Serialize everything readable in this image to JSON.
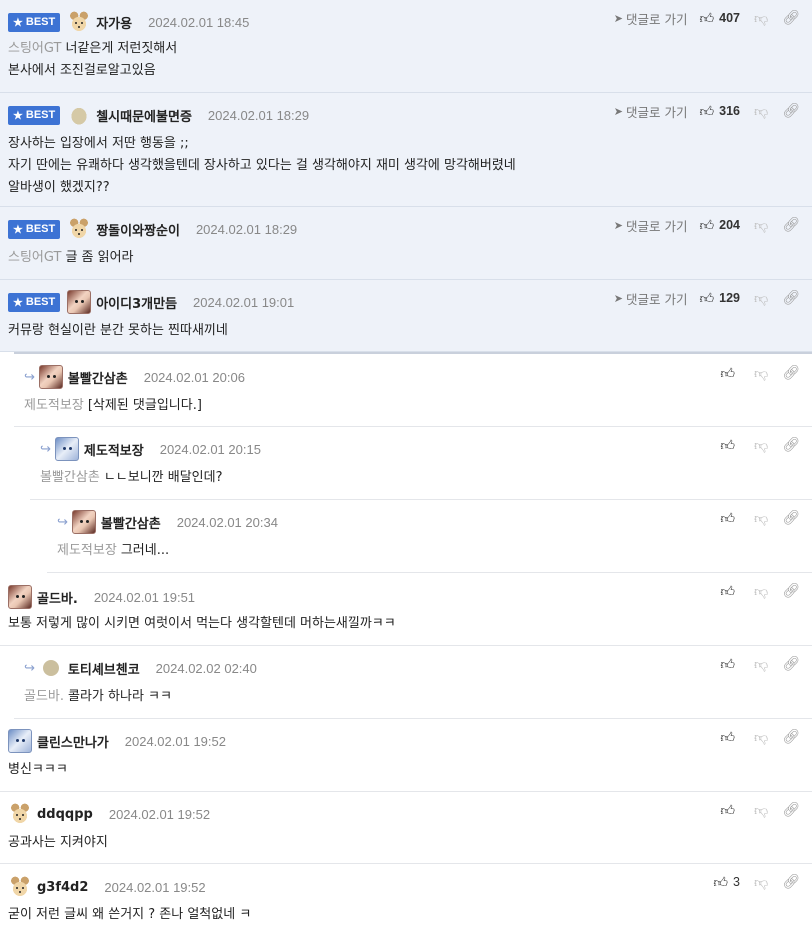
{
  "ui": {
    "best_label": "BEST",
    "goto_label": "댓글로 가기"
  },
  "comments": [
    {
      "nick": "자가용",
      "time": "2024.02.01 18:45",
      "likes": "407",
      "ref": "스팅어GT",
      "lines": [
        "너같은게 저런짓해서",
        "본사에서 조진걸로알고있음"
      ]
    },
    {
      "nick": "첼시때문에불면증",
      "time": "2024.02.01 18:29",
      "likes": "316",
      "lines": [
        "장사하는 입장에서 저딴 행동을 ;;",
        "자기 딴에는 유쾌하다 생각했을텐데 장사하고 있다는 걸 생각해야지 재미 생각에 망각해버렸네",
        "알바생이 했겠지??"
      ]
    },
    {
      "nick": "짱돌이와짱순이",
      "time": "2024.02.01 18:29",
      "likes": "204",
      "ref": "스팅어GT",
      "lines": [
        "글 좀 읽어라"
      ]
    },
    {
      "nick": "아이디3개만듬",
      "time": "2024.02.01 19:01",
      "likes": "129",
      "lines": [
        "커뮤랑 현실이란 분간 못하는 찐따새끼네"
      ]
    },
    {
      "nick": "볼빨간삼촌",
      "time": "2024.02.01 20:06",
      "ref": "제도적보장",
      "lines": [
        "[삭제된 댓글입니다.]"
      ]
    },
    {
      "nick": "제도적보장",
      "time": "2024.02.01 20:15",
      "ref": "볼빨간삼촌",
      "lines": [
        "ㄴㄴ보니깐 배달인데?"
      ]
    },
    {
      "nick": "볼빨간삼촌",
      "time": "2024.02.01 20:34",
      "ref": "제도적보장",
      "lines": [
        "그러네..."
      ]
    },
    {
      "nick": "골드바.",
      "time": "2024.02.01 19:51",
      "lines": [
        "보통 저렇게 많이 시키면 여럿이서 먹는다 생각할텐데 머하는새낄까ㅋㅋ"
      ]
    },
    {
      "nick": "토티셰브첸코",
      "time": "2024.02.02 02:40",
      "ref": "골드바.",
      "lines": [
        "콜라가 하나라 ㅋㅋ"
      ]
    },
    {
      "nick": "클린스만나가",
      "time": "2024.02.01 19:52",
      "lines": [
        "병신ㅋㅋㅋ"
      ]
    },
    {
      "nick": "ddqqpp",
      "time": "2024.02.01 19:52",
      "lines": [
        "공과사는 지켜야지"
      ]
    },
    {
      "nick": "g3f4d2",
      "time": "2024.02.01 19:52",
      "likes": "3",
      "lines": [
        "굳이 저런 글씨 왜 쓴거지 ? 존나 얼척없네 ㅋ"
      ]
    }
  ]
}
